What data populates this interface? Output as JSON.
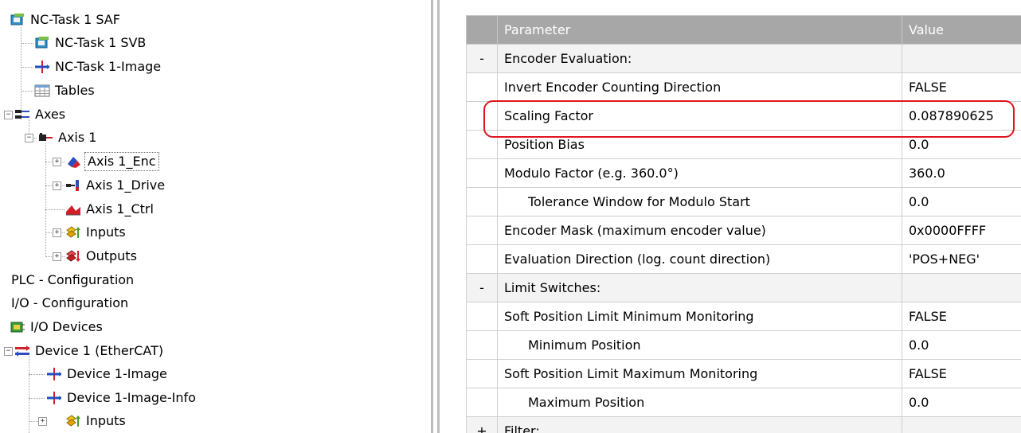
{
  "tree": {
    "nodes": [
      {
        "label": "NC-Task 1 SAF",
        "icon": "task-icon"
      },
      {
        "label": "NC-Task 1 SVB",
        "icon": "task-icon"
      },
      {
        "label": "NC-Task 1-Image",
        "icon": "image-icon"
      },
      {
        "label": "Tables",
        "icon": "table-icon"
      },
      {
        "label": "Axes",
        "icon": "axes-icon",
        "toggle": "−"
      },
      {
        "label": "Axis 1",
        "icon": "axis-icon",
        "toggle": "−"
      },
      {
        "label": "Axis 1_Enc",
        "icon": "encoder-icon",
        "toggle": "+"
      },
      {
        "label": "Axis 1_Drive",
        "icon": "drive-icon",
        "toggle": "+"
      },
      {
        "label": "Axis 1_Ctrl",
        "icon": "controller-icon"
      },
      {
        "label": "Inputs",
        "icon": "inputs-icon",
        "toggle": "+"
      },
      {
        "label": "Outputs",
        "icon": "outputs-icon",
        "toggle": "+"
      },
      {
        "label": "PLC - Configuration",
        "icon": ""
      },
      {
        "label": "I/O - Configuration",
        "icon": ""
      },
      {
        "label": "I/O Devices",
        "icon": "io-devices-icon"
      },
      {
        "label": "Device 1 (EtherCAT)",
        "icon": "ethercat-icon",
        "toggle": "−"
      },
      {
        "label": "Device 1-Image",
        "icon": "image-icon"
      },
      {
        "label": "Device 1-Image-Info",
        "icon": "image-icon"
      },
      {
        "label": "Inputs",
        "icon": "inputs-icon",
        "toggle": "+"
      }
    ]
  },
  "grid": {
    "headers": {
      "parameter": "Parameter",
      "value": "Value"
    },
    "rows": [
      {
        "marker": "-",
        "parameter": "Encoder Evaluation:",
        "value": "",
        "section": true
      },
      {
        "marker": "",
        "parameter": "Invert Encoder Counting Direction",
        "value": "FALSE"
      },
      {
        "marker": "",
        "parameter": "Scaling Factor",
        "value": "0.087890625",
        "highlighted": true
      },
      {
        "marker": "",
        "parameter": "Position Bias",
        "value": "0.0"
      },
      {
        "marker": "",
        "parameter": "Modulo Factor (e.g. 360.0°)",
        "value": "360.0"
      },
      {
        "marker": "",
        "parameter": "Tolerance Window for Modulo Start",
        "value": "0.0",
        "indent": true
      },
      {
        "marker": "",
        "parameter": "Encoder Mask (maximum encoder value)",
        "value": "0x0000FFFF"
      },
      {
        "marker": "",
        "parameter": "Evaluation Direction (log. count direction)",
        "value": "'POS+NEG'"
      },
      {
        "marker": "-",
        "parameter": "Limit Switches:",
        "value": "",
        "section": true
      },
      {
        "marker": "",
        "parameter": "Soft Position Limit Minimum Monitoring",
        "value": "FALSE"
      },
      {
        "marker": "",
        "parameter": "Minimum Position",
        "value": "0.0",
        "indent": true
      },
      {
        "marker": "",
        "parameter": "Soft Position Limit Maximum Monitoring",
        "value": "FALSE"
      },
      {
        "marker": "",
        "parameter": "Maximum Position",
        "value": "0.0",
        "indent": true
      },
      {
        "marker": "+",
        "parameter": "Filter:",
        "value": "",
        "section": true
      }
    ]
  },
  "colors": {
    "header_bg": "#a7a7a7",
    "highlight_border": "#e0141e",
    "section_bg": "#f3f3f3"
  }
}
